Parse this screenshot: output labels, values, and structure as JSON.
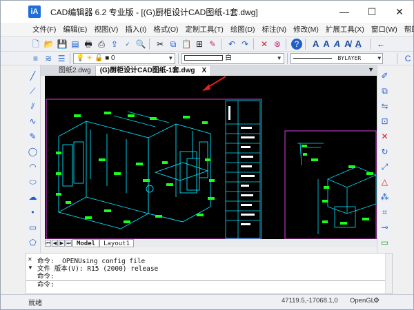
{
  "window": {
    "app_icon": "iA",
    "title": "CAD编辑器 6.2 专业版  - [(G)厨柜设计CAD图纸-1套.dwg]",
    "minimize": "—",
    "maximize": "☐",
    "close": "✕"
  },
  "menu": [
    "文件(F)",
    "编辑(E)",
    "视图(V)",
    "插入(I)",
    "格式(O)",
    "定制工具(T)",
    "绘图(D)",
    "标注(N)",
    "修改(M)",
    "扩展工具(X)",
    "窗口(W)",
    "帮助(H)"
  ],
  "toolbar2": {
    "layer_value": "0",
    "color_value": "白",
    "linetype_value": "BYLAYER"
  },
  "doc_tabs": {
    "tab1": "图纸2.dwg",
    "tab2": "(G)厨柜设计CAD图纸-1套.dwg",
    "close": "X"
  },
  "layout_tabs": {
    "model": "Model",
    "layout1": "Layout1"
  },
  "command": {
    "lines": [
      "命令:  _OPENUsing config file",
      "文件 版本(V): R15 (2000) release",
      "命令:"
    ],
    "prompt": "命令:"
  },
  "status": {
    "left_text": "就绪",
    "coords": "47119.5,-17068.1,0",
    "renderer": "OpenGL"
  },
  "colors": {
    "canvas_bg": "#000000",
    "drawing_cyan": "#00e5ff",
    "drawing_green": "#18ff18",
    "drawing_magenta": "#e040e0",
    "annotation_arrow": "#e02020"
  }
}
